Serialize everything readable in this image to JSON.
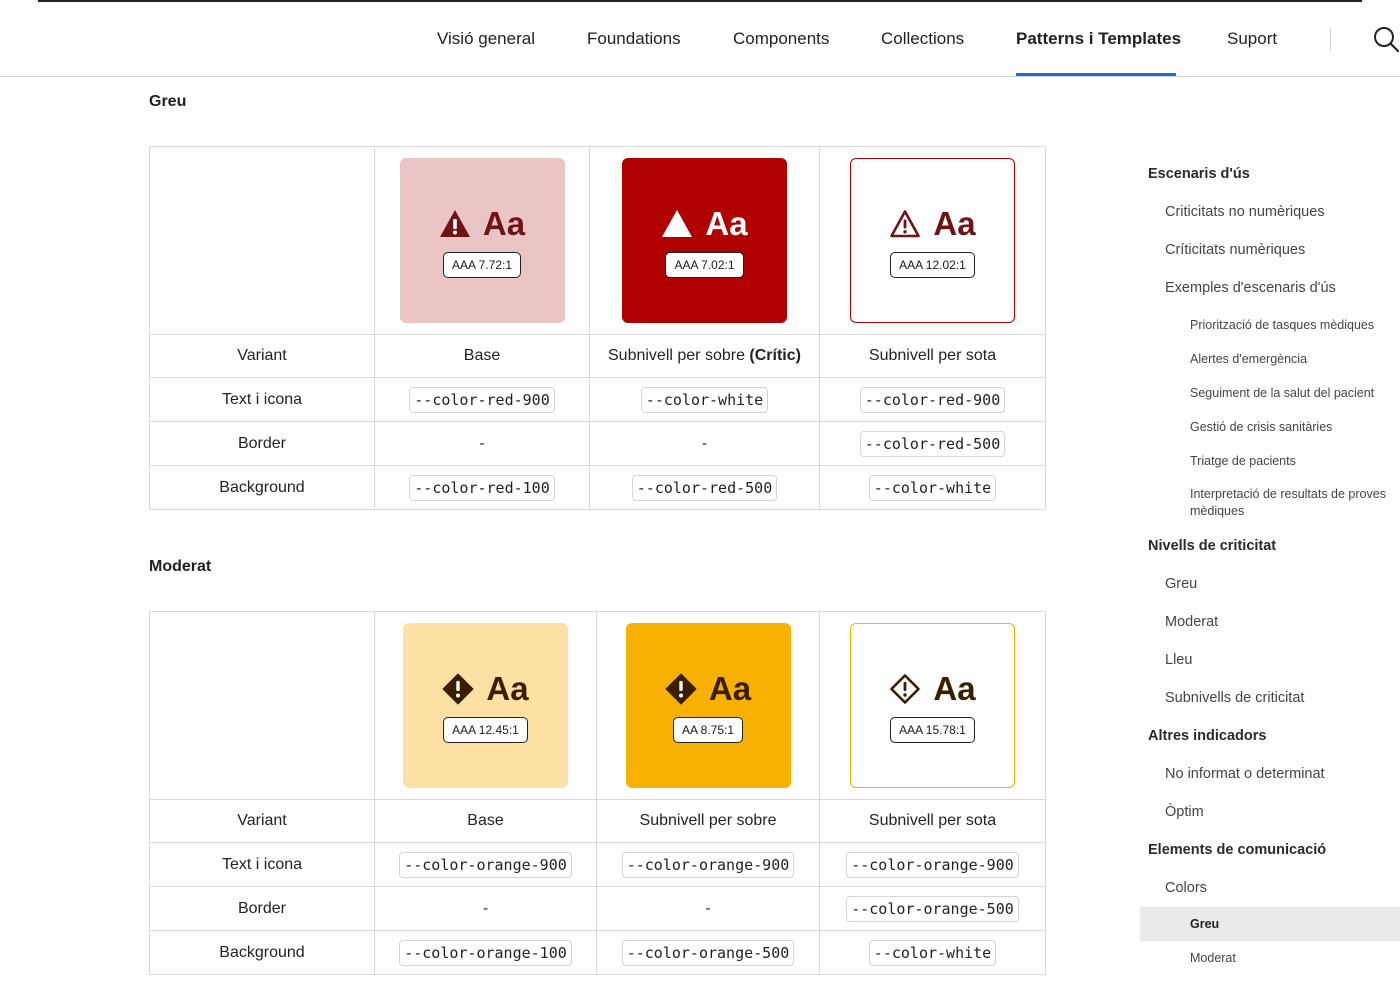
{
  "nav": {
    "items": [
      "Visió general",
      "Foundations",
      "Components",
      "Collections",
      "Patterns i Templates",
      "Suport"
    ],
    "active": "Patterns i Templates",
    "search_icon": "search-icon"
  },
  "sections": [
    {
      "title": "Greu",
      "icon": "warning-triangle-icon",
      "columns": [
        {
          "variant": "Base",
          "variant_suffix": "",
          "ratio": "AAA 7.72:1",
          "text_icon": "--color-red-900",
          "border": "-",
          "background": "--color-red-100",
          "swatch_bg": "#ebc4c6",
          "swatch_border": "#ebc4c6",
          "fg": "#6e1414"
        },
        {
          "variant": "Subnivell per sobre ",
          "variant_suffix": "(Crític)",
          "ratio": "AAA 7.02:1",
          "text_icon": "--color-white",
          "border": "-",
          "background": "--color-red-500",
          "swatch_bg": "#b00000",
          "swatch_border": "#b00000",
          "fg": "#ffffff"
        },
        {
          "variant": "Subnivell per sota",
          "variant_suffix": "",
          "ratio": "AAA 12.02:1",
          "text_icon": "--color-red-900",
          "border": "--color-red-500",
          "background": "--color-white",
          "swatch_bg": "#ffffff",
          "swatch_border": "#b00000",
          "fg": "#6e1414"
        }
      ],
      "rows": {
        "variant": "Variant",
        "text_icon": "Text i icona",
        "border": "Border",
        "background": "Background"
      }
    },
    {
      "title": "Moderat",
      "icon": "warning-diamond-icon",
      "columns": [
        {
          "variant": "Base",
          "variant_suffix": "",
          "ratio": "AAA 12.45:1",
          "text_icon": "--color-orange-900",
          "border": "-",
          "background": "--color-orange-100",
          "swatch_bg": "#fde0a3",
          "swatch_border": "#fde0a3",
          "fg": "#3b1d00"
        },
        {
          "variant": "Subnivell per sobre",
          "variant_suffix": "",
          "ratio": "AA 8.75:1",
          "text_icon": "--color-orange-900",
          "border": "-",
          "background": "--color-orange-500",
          "swatch_bg": "#f7b100",
          "swatch_border": "#f7b100",
          "fg": "#3b1d00"
        },
        {
          "variant": "Subnivell per sota",
          "variant_suffix": "",
          "ratio": "AAA 15.78:1",
          "text_icon": "--color-orange-900",
          "border": "--color-orange-500",
          "background": "--color-white",
          "swatch_bg": "#ffffff",
          "swatch_border": "#f7b100",
          "fg": "#3b1d00"
        }
      ],
      "rows": {
        "variant": "Variant",
        "text_icon": "Text i icona",
        "border": "Border",
        "background": "Background"
      }
    }
  ],
  "swatch_label": "Aa",
  "toc": [
    {
      "label": "Escenaris d'ús",
      "level": 1
    },
    {
      "label": "Criticitats no numèriques",
      "level": 2
    },
    {
      "label": "Críticitats numèriques",
      "level": 2
    },
    {
      "label": "Exemples d'escenaris d'ús",
      "level": 2
    },
    {
      "label": "Priorització de tasques mèdiques",
      "level": 3
    },
    {
      "label": "Alertes d'emergència",
      "level": 3
    },
    {
      "label": "Seguiment de la salut del pacient",
      "level": 3
    },
    {
      "label": "Gestió de crisis sanitàries",
      "level": 3
    },
    {
      "label": "Triatge de pacients",
      "level": 3
    },
    {
      "label": "Interpretació de resultats de proves mèdiques",
      "level": 3
    },
    {
      "label": "Nivells de criticitat",
      "level": 1
    },
    {
      "label": "Greu",
      "level": 2
    },
    {
      "label": "Moderat",
      "level": 2
    },
    {
      "label": "Lleu",
      "level": 2
    },
    {
      "label": "Subnivells de criticitat",
      "level": 2
    },
    {
      "label": "Altres indicadors",
      "level": 1
    },
    {
      "label": "No informat o determinat",
      "level": 2
    },
    {
      "label": "Òptim",
      "level": 2
    },
    {
      "label": "Elements de comunicació",
      "level": 1
    },
    {
      "label": "Colors",
      "level": 2
    },
    {
      "label": "Greu",
      "level": 3,
      "active": true
    },
    {
      "label": "Moderat",
      "level": 3
    }
  ]
}
